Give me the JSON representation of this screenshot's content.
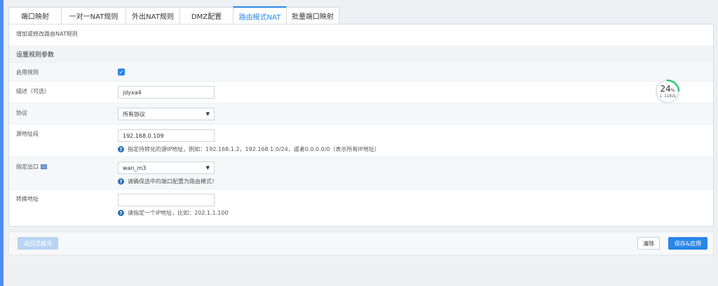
{
  "tabs": [
    {
      "label": "端口映射",
      "active": false
    },
    {
      "label": "一对一NAT规则",
      "active": false
    },
    {
      "label": "外出NAT规则",
      "active": false
    },
    {
      "label": "DMZ配置",
      "active": false
    },
    {
      "label": "路由模式NAT",
      "active": true
    },
    {
      "label": "批量端口映射",
      "active": false
    }
  ],
  "panel": {
    "description": "增加或修改路由NAT规则",
    "section_title": "设置规则参数"
  },
  "form": {
    "enable": {
      "label": "启用规则",
      "checked": true
    },
    "description": {
      "label": "描述（可选）",
      "value": "jdyxa4"
    },
    "protocol": {
      "label": "协议",
      "value": "所有协议"
    },
    "source": {
      "label": "源地址段",
      "value": "192.168.0.109",
      "hint": "指定待转化的源IP地址，例如：192.168.1.2，192.168.1.0/24，或者0.0.0.0/0（表示所有IP地址）"
    },
    "egress": {
      "label": "指定出口",
      "value": "wan_m3",
      "hint": "请确保选中的端口配置为路由模式！"
    },
    "translated": {
      "label": "转换地址",
      "value": "",
      "hint": "请指定一个IP地址，比如：202.1.1.100"
    }
  },
  "footer": {
    "back_label": "返回至概况",
    "clear_label": "清除",
    "save_label": "保存&应用"
  },
  "gauge": {
    "percent": "24",
    "unit": "%",
    "speed": "↓ 11K/s",
    "fraction": 0.24
  },
  "colors": {
    "accent": "#2a86e6",
    "gauge": "#2ecc71"
  }
}
